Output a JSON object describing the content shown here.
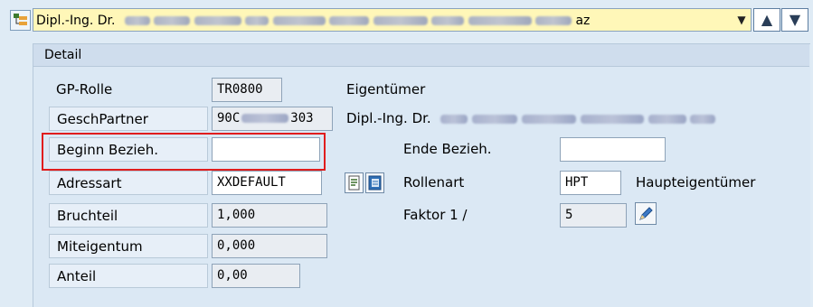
{
  "header": {
    "combo_prefix": "Dipl.-Ing. Dr.",
    "combo_suffix": "az",
    "dropdown_arrow": "▼",
    "nav_up": "▲",
    "nav_down": "▼"
  },
  "detail": {
    "title": "Detail",
    "gp_rolle": {
      "label": "GP-Rolle",
      "value": "TR0800"
    },
    "eigentuemer": {
      "label": "Eigentümer"
    },
    "geschpartner": {
      "label": "GeschPartner",
      "value_start": "90C",
      "value_end": "303",
      "name_prefix": "Dipl.-Ing. Dr."
    },
    "beginn": {
      "label": "Beginn Bezieh.",
      "value": ""
    },
    "ende": {
      "label": "Ende Bezieh.",
      "value": ""
    },
    "adressart": {
      "label": "Adressart",
      "value": "XXDEFAULT"
    },
    "rollenart": {
      "label": "Rollenart",
      "value": "HPT",
      "description": "Haupteigentümer"
    },
    "bruchteil": {
      "label": "Bruchteil",
      "value": "1,000"
    },
    "faktor": {
      "label": "Faktor 1 /",
      "value": "5"
    },
    "miteigentum": {
      "label": "Miteigentum",
      "value": "0,000"
    },
    "anteil": {
      "label": "Anteil",
      "value": "0,00"
    }
  },
  "colors": {
    "background": "#dfebf5",
    "combo_background": "#fff7b8",
    "highlight": "#e01d1d"
  },
  "icons": [
    "hierarchy-icon",
    "dropdown-arrow-icon",
    "arrow-up-icon",
    "arrow-down-icon",
    "document-icon",
    "address-book-icon",
    "pencil-icon"
  ]
}
